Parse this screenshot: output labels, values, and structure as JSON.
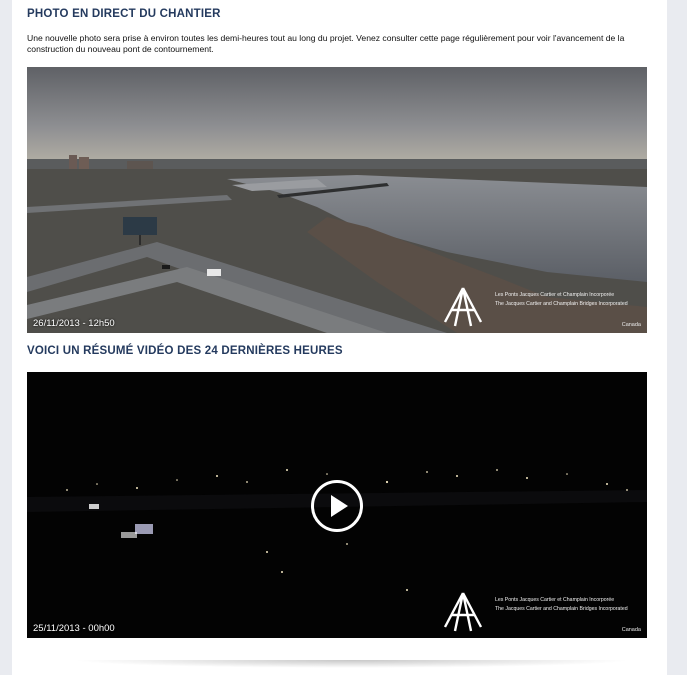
{
  "section_live": {
    "title": "PHOTO EN DIRECT DU CHANTIER",
    "intro": "Une nouvelle photo sera prise à environ toutes les demi-heures tout au long du projet. Venez consulter cette page régulièrement pour voir l'avancement de la construction du nouveau pont de contournement.",
    "photo": {
      "timestamp": "26/11/2013 - 12h50",
      "logo_line_fr": "Les Ponts Jacques Cartier et Champlain Incorporée",
      "logo_line_en": "The Jacques Cartier and Champlain Bridges Incorporated",
      "logo_gov": "Canada"
    }
  },
  "section_video": {
    "title": "VOICI UN RÉSUMÉ VIDÉO DES 24 DERNIÈRES HEURES",
    "video": {
      "timestamp": "25/11/2013 - 00h00",
      "logo_line_fr": "Les Ponts Jacques Cartier et Champlain Incorporée",
      "logo_line_en": "The Jacques Cartier and Champlain Bridges Incorporated",
      "logo_gov": "Canada",
      "play_icon": "play-icon"
    }
  }
}
